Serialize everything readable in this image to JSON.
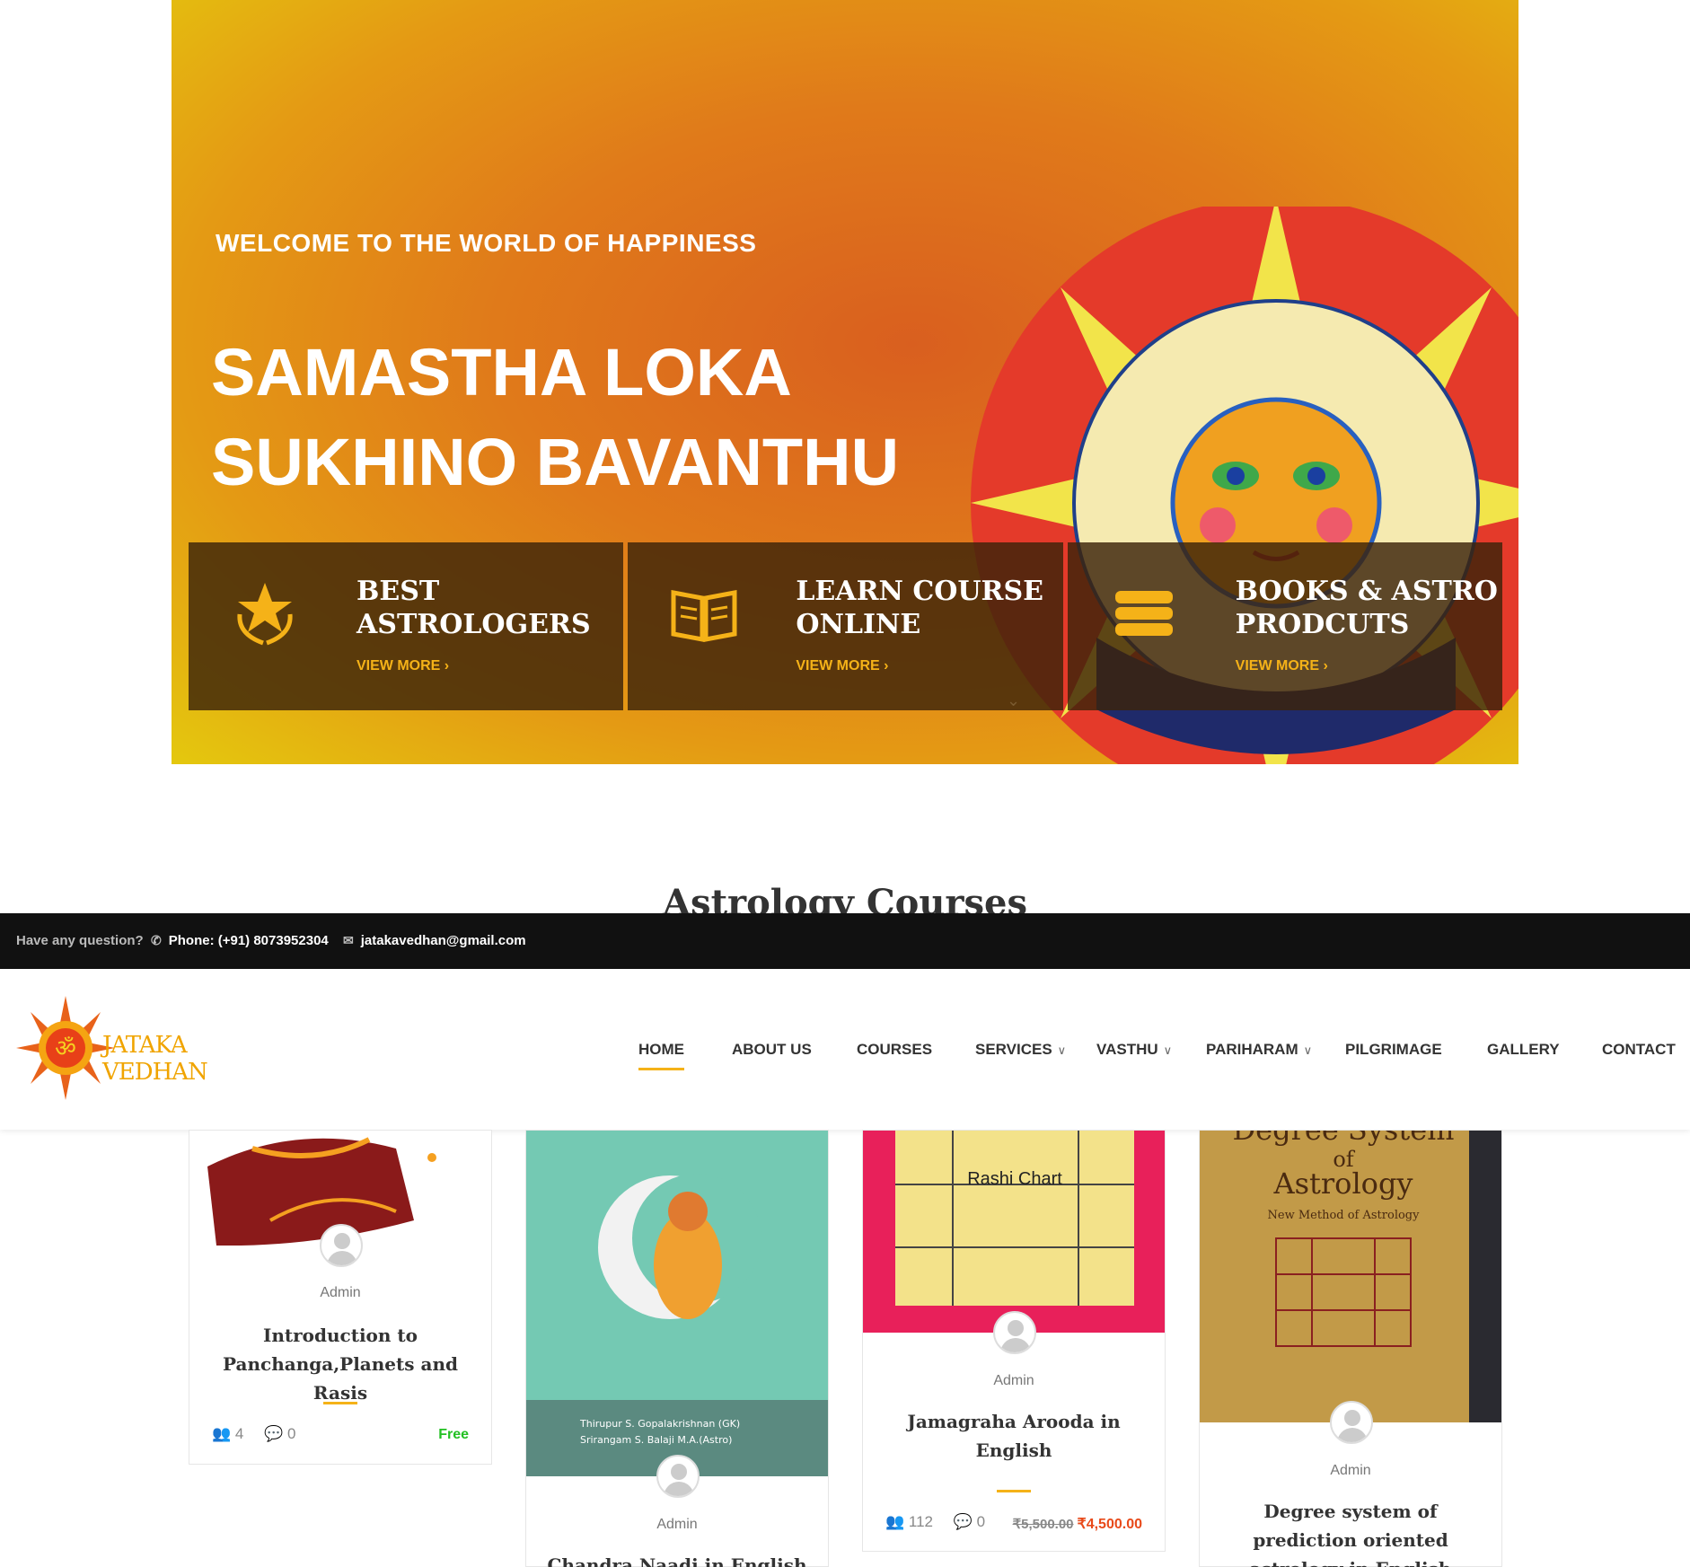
{
  "hero": {
    "welcome": "WELCOME TO THE WORLD OF HAPPINESS",
    "title_line1": "SAMASTHA LOKA",
    "title_line2": "SUKHINO BAVANTHU",
    "features": [
      {
        "title_line1": "BEST",
        "title_line2": "ASTROLOGERS",
        "link": "VIEW MORE",
        "icon": "laurel-star-icon"
      },
      {
        "title_line1": "LEARN COURSE",
        "title_line2": "ONLINE",
        "link": "VIEW MORE",
        "icon": "open-book-icon"
      },
      {
        "title_line1": "BOOKS & ASTRO",
        "title_line2": "PRODCUTS",
        "link": "VIEW MORE",
        "icon": "book-stack-icon"
      }
    ]
  },
  "section_title": "Astrology Courses",
  "topbar": {
    "question": "Have any question?",
    "phone": "Phone: (+91) 8073952304",
    "email": "jatakavedhan@gmail.com"
  },
  "header": {
    "logo_text": "JATAKA VEDHAN",
    "nav": [
      "HOME",
      "ABOUT US",
      "COURSES",
      "SERVICES",
      "VASTHU",
      "PARIHARAM",
      "PILGRIMAGE",
      "GALLERY",
      "CONTACT"
    ],
    "active": "HOME"
  },
  "courses": [
    {
      "author": "Admin",
      "title": "Introduction to Panchanga,Planets and Rasis",
      "students": "4",
      "comments": "0",
      "price": "Free"
    },
    {
      "author": "Admin",
      "title": "Chandra Naadi in English",
      "image_text1": "Thirupur S. Gopalakrishnan (GK)",
      "image_text2": "Srirangam S. Balaji M.A.(Astro)"
    },
    {
      "author": "Admin",
      "title": "Jamagraha Arooda in English",
      "students": "112",
      "comments": "0",
      "old_price": "₹5,500.00",
      "price": "₹4,500.00",
      "image_text": "Rashi Chart"
    },
    {
      "author": "Admin",
      "title": "Degree system of prediction oriented astrology in English",
      "image_title1": "Degree System",
      "image_title2": "of",
      "image_title3": "Astrology",
      "image_sub": "New Method of Astrology"
    }
  ]
}
